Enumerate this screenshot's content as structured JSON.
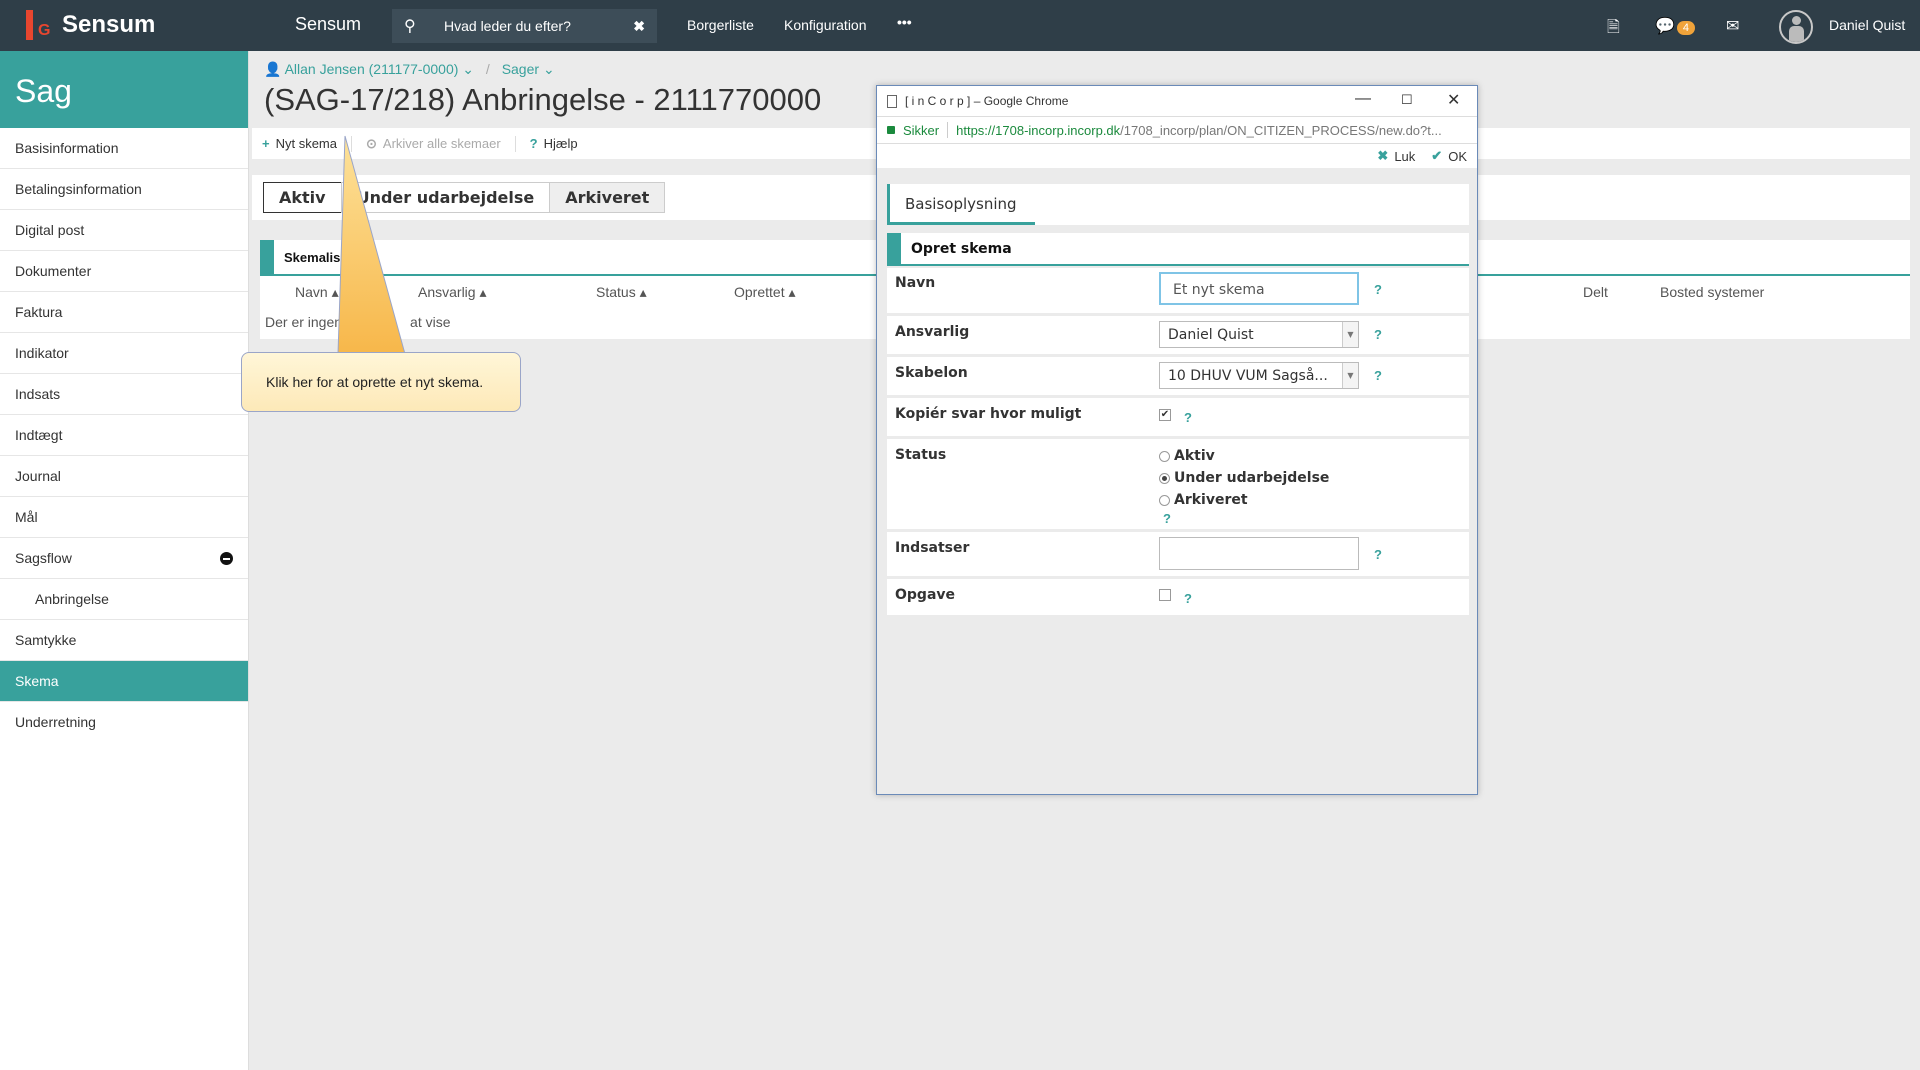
{
  "topbar": {
    "brand": "Sensum",
    "logo_letters": "EG",
    "app_title": "Sensum",
    "search_placeholder": "Hvad leder du efter?",
    "nav": [
      "Borgerliste",
      "Konfiguration"
    ],
    "more": "•••",
    "notification_count": "4",
    "user_name": "Daniel Quist"
  },
  "sidebar": {
    "header": "Sag",
    "items": [
      {
        "label": "Basisinformation"
      },
      {
        "label": "Betalingsinformation"
      },
      {
        "label": "Digital post"
      },
      {
        "label": "Dokumenter"
      },
      {
        "label": "Faktura"
      },
      {
        "label": "Indikator"
      },
      {
        "label": "Indsats"
      },
      {
        "label": "Indtægt"
      },
      {
        "label": "Journal"
      },
      {
        "label": "Mål"
      },
      {
        "label": "Sagsflow"
      },
      {
        "label": "Anbringelse"
      },
      {
        "label": "Samtykke"
      },
      {
        "label": "Skema"
      },
      {
        "label": "Underretning"
      }
    ]
  },
  "breadcrumb": {
    "person": "Allan Jensen (211177-0000)",
    "section": "Sager"
  },
  "page_title": "(SAG-17/218) Anbringelse - 2111770000",
  "toolbar": {
    "new_schema": "Nyt skema",
    "archive_all": "Arkiver alle skemaer",
    "help": "Hjælp"
  },
  "status_tabs": [
    "Aktiv",
    "Under udarbejdelse",
    "Arkiveret"
  ],
  "list": {
    "title": "Skemalis",
    "columns": [
      "Navn",
      "Ansvarlig",
      "Status",
      "Oprettet",
      "Delt",
      "Bosted systemer"
    ],
    "empty_text_start": "Der er ingen",
    "empty_text_end": "at vise"
  },
  "callout": {
    "text": "Klik her for at oprette et nyt skema."
  },
  "popup": {
    "window_title": "[ i n C o r p ] – Google Chrome",
    "secure_label": "Sikker",
    "url_host": "https://1708-incorp.incorp.dk",
    "url_path": "/1708_incorp/plan/ON_CITIZEN_PROCESS/new.do?t...",
    "close_label": "Luk",
    "ok_label": "OK",
    "tab": "Basisoplysning",
    "form_title": "Opret skema",
    "fields": {
      "name_label": "Navn",
      "name_value": "Et nyt skema",
      "owner_label": "Ansvarlig",
      "owner_value": "Daniel Quist",
      "template_label": "Skabelon",
      "template_value": "10 DHUV VUM Sagså...",
      "copy_label": "Kopiér svar hvor muligt",
      "copy_checked": true,
      "status_label": "Status",
      "status_options": [
        "Aktiv",
        "Under udarbejdelse",
        "Arkiveret"
      ],
      "status_selected": "Under udarbejdelse",
      "interventions_label": "Indsatser",
      "interventions_value": "",
      "task_label": "Opgave",
      "task_checked": false
    },
    "help_mark": "?"
  }
}
